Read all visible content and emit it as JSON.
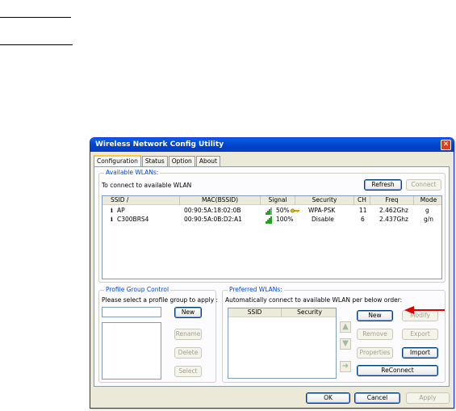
{
  "window": {
    "title": "Wireless Network Config Utility"
  },
  "tabs": [
    "Configuration",
    "Status",
    "Option",
    "About"
  ],
  "available": {
    "legend": "Available WLANs:",
    "caption": "To connect to available WLAN",
    "refresh": "Refresh",
    "connect": "Connect",
    "columns": [
      "SSID  /",
      "MAC(BSSID)",
      "Signal",
      "Security",
      "CH",
      "Freq",
      "Mode"
    ],
    "rows": [
      {
        "ssid": "AP",
        "mac": "00:90:5A:18:02:0B",
        "signal": "50%",
        "security": "WPA-PSK",
        "ch": "11",
        "freq": "2.462Ghz",
        "mode": "g",
        "signal_level": 0.5,
        "secured": true
      },
      {
        "ssid": "C300BRS4",
        "mac": "00:90:5A:0B:D2:A1",
        "signal": "100%",
        "security": "Disable",
        "ch": "6",
        "freq": "2.437Ghz",
        "mode": "g/n",
        "signal_level": 1.0,
        "secured": false
      }
    ]
  },
  "profile": {
    "legend": "Profile Group Control",
    "caption": "Please select a profile group to apply :",
    "new": "New",
    "rename": "Rename",
    "delete": "Delete",
    "select": "Select"
  },
  "preferred": {
    "legend": "Preferred WLANs:",
    "caption": "Automatically connect to available WLAN per below order:",
    "columns": [
      "SSID",
      "Security"
    ],
    "new": "New",
    "modify": "Modify",
    "remove": "Remove",
    "export": "Export",
    "properties": "Properties",
    "import": "Import",
    "reconnect": "ReConnect"
  },
  "footer": {
    "ok": "OK",
    "cancel": "Cancel",
    "apply": "Apply"
  },
  "colors": {
    "title_bar": "#0a5fe8",
    "legend_text": "#0046d5",
    "signal_bar": "#21a121",
    "key": "#e8b800",
    "annotation_arrow": "#e00000"
  }
}
